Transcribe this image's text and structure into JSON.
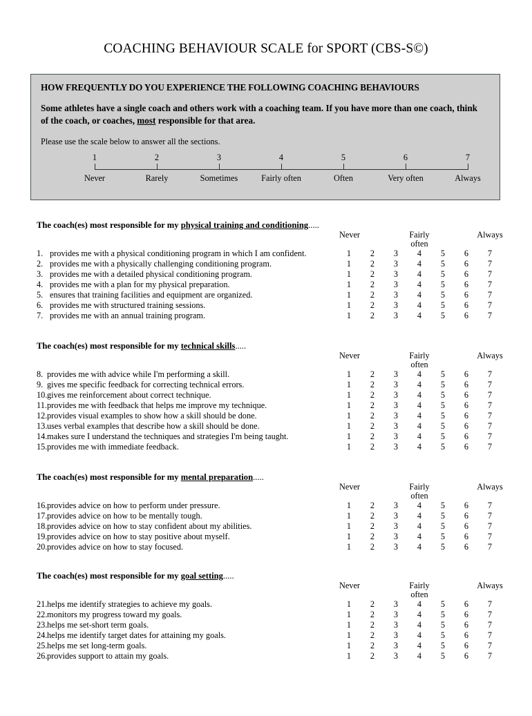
{
  "title": "COACHING BEHAVIOUR SCALE for SPORT (CBS-S©)",
  "instructions": {
    "heading": "HOW FREQUENTLY DO YOU EXPERIENCE THE FOLLOWING COACHING BEHAVIOURS",
    "paragraph_part1": "Some athletes have a single coach and others work with a coaching team.  If you have more than one coach, think of the coach, or coaches, ",
    "paragraph_emphasis": "most",
    "paragraph_part2": " responsible for that area.",
    "note": "Please use the scale below to answer all the sections."
  },
  "scale": {
    "points": [
      {
        "number": "1",
        "label": "Never"
      },
      {
        "number": "2",
        "label": "Rarely"
      },
      {
        "number": "3",
        "label": "Sometimes"
      },
      {
        "number": "4",
        "label": "Fairly often"
      },
      {
        "number": "5",
        "label": "Often"
      },
      {
        "number": "6",
        "label": "Very often"
      },
      {
        "number": "7",
        "label": "Always"
      }
    ]
  },
  "anchors": {
    "low": "Never",
    "mid_line1": "Fairly",
    "mid_line2": "often",
    "high": "Always"
  },
  "response_options": [
    "1",
    "2",
    "3",
    "4",
    "5",
    "6",
    "7"
  ],
  "sections": [
    {
      "title_prefix": "The coach(es) most responsible for my ",
      "title_topic": "physical training and conditioning",
      "title_dots": ".....",
      "items": [
        {
          "num": "1.",
          "text": "provides me with a physical conditioning program in which I am confident."
        },
        {
          "num": "2.",
          "text": "provides me with a physically challenging conditioning program."
        },
        {
          "num": "3.",
          "text": "provides me with a detailed physical conditioning program."
        },
        {
          "num": "4.",
          "text": "provides me with a plan for my physical preparation."
        },
        {
          "num": "5.",
          "text": "ensures that training facilities and equipment are organized."
        },
        {
          "num": "6.",
          "text": "provides me with structured training sessions."
        },
        {
          "num": "7.",
          "text": "provides me with an annual training program."
        }
      ]
    },
    {
      "title_prefix": "The coach(es) most responsible for my ",
      "title_topic": "technical skills",
      "title_dots": ".....",
      "items": [
        {
          "num": "8.",
          "text": "provides me with advice while I'm performing a skill."
        },
        {
          "num": "9.",
          "text": "gives me specific feedback for correcting technical errors."
        },
        {
          "num": "10.",
          "text": "gives me reinforcement about correct technique."
        },
        {
          "num": "11.",
          "text": "provides me with feedback that helps me improve my technique."
        },
        {
          "num": "12.",
          "text": "provides visual examples to show how a skill should be done."
        },
        {
          "num": "13.",
          "text": "uses verbal examples that describe how a skill should be done."
        },
        {
          "num": "14.",
          "text": "makes sure I understand the techniques and strategies I'm being taught."
        },
        {
          "num": "15.",
          "text": "provides me with immediate feedback."
        }
      ]
    },
    {
      "title_prefix": "The coach(es) most responsible for my ",
      "title_topic": "mental preparation",
      "title_dots": ".....",
      "items": [
        {
          "num": "16.",
          "text": "provides advice on how to perform under pressure."
        },
        {
          "num": "17.",
          "text": "provides advice on how to be mentally tough."
        },
        {
          "num": "18.",
          "text": "provides advice on how to stay confident about my abilities."
        },
        {
          "num": "19.",
          "text": "provides advice on how to stay positive about myself."
        },
        {
          "num": "20.",
          "text": "provides advice on how to stay focused."
        }
      ]
    },
    {
      "title_prefix": "The coach(es) most responsible for my ",
      "title_topic": "goal setting",
      "title_dots": ".....",
      "items": [
        {
          "num": "21.",
          "text": "helps me identify strategies to achieve my goals."
        },
        {
          "num": "22.",
          "text": "monitors my progress toward my goals."
        },
        {
          "num": "23.",
          "text": "helps me set-short term goals."
        },
        {
          "num": "24.",
          "text": "helps me identify target dates for attaining my goals."
        },
        {
          "num": "25.",
          "text": "helps me set long-term goals."
        },
        {
          "num": "26.",
          "text": "provides support to attain my goals."
        }
      ]
    }
  ],
  "colors": {
    "panel_background": "#cfcfcf",
    "panel_border": "#4a5450",
    "text": "#000000",
    "page_background": "#ffffff"
  }
}
